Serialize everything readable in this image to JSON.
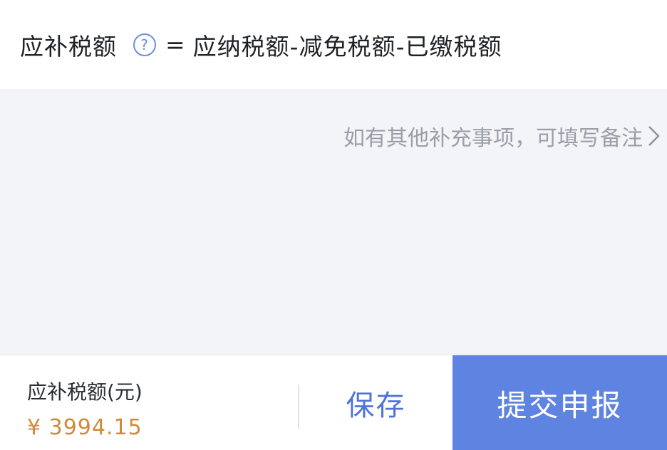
{
  "formula": {
    "term": "应补税额",
    "help_icon": "question-circle-icon",
    "equals": "=",
    "expression": "应纳税额-减免税额-已缴税额"
  },
  "note": {
    "placeholder": "如有其他补充事项，可填写备注",
    "chevron_icon": "chevron-right-icon"
  },
  "footer": {
    "amount_label": "应补税额(元)",
    "amount_value": "¥ 3994.15",
    "save_label": "保存",
    "submit_label": "提交申报"
  },
  "colors": {
    "accent": "#5f83e0",
    "link_text": "#4f74d8",
    "amount": "#d08a3a",
    "panel_bg": "#f3f4f8"
  }
}
